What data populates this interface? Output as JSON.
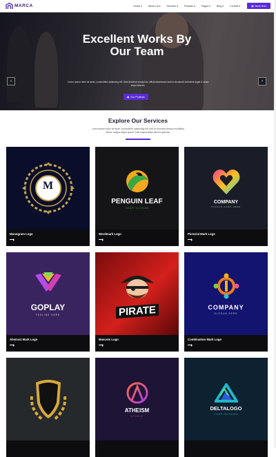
{
  "header": {
    "brand": "MARCA",
    "nav": [
      "Home",
      "About Us",
      "Services",
      "Portfolio",
      "Pages",
      "Blog",
      "Contact"
    ],
    "cta": "Book Now"
  },
  "hero": {
    "title_line1": "Excellent Works By",
    "title_line2": "Our Team",
    "subtitle": "Lorem ipsum dolor sit amet, consectetur adipiscing elit. Duis tincidunt suscipit ac officia laboriosam autem obcaecati dominicis fugiat & sequi sequi dolores.",
    "button": "Our Portfolio"
  },
  "services": {
    "title": "Explore Our Services",
    "desc": "Lorem ipsum dolor sit amet, consectetur adipiscing elit, sed do eiusmod tempor incididunt labore magna aliqua ipsum Quis suspendisse ultrices gravida.",
    "cards": [
      {
        "label": "Monogram Logo",
        "brand": "M",
        "tagline": ""
      },
      {
        "label": "Wordmark Logo",
        "brand": "PENGUIN LEAF",
        "tagline": "YOUR SLOGAN"
      },
      {
        "label": "Pictorial Mark Logo",
        "brand": "COMPANY",
        "tagline": "SLOGAN GOES HERE"
      },
      {
        "label": "Abstract Mark Logo",
        "brand": "GOPLAY",
        "tagline": "TAGLINE HERE"
      },
      {
        "label": "Mascots Logo",
        "brand": "PIRATE",
        "tagline": ""
      },
      {
        "label": "Combination Mark Logo",
        "brand": "COMPANY",
        "tagline": "SLOGAN HERE"
      },
      {
        "label": "",
        "brand": "",
        "tagline": ""
      },
      {
        "label": "",
        "brand": "ATHEISM",
        "tagline": "STUDIO"
      },
      {
        "label": "",
        "brand": "DELTALOGO",
        "tagline": "YOUR SLOGAN"
      }
    ]
  },
  "colors": {
    "accent": "#5b2bd6",
    "dark": "#0d0d10"
  }
}
